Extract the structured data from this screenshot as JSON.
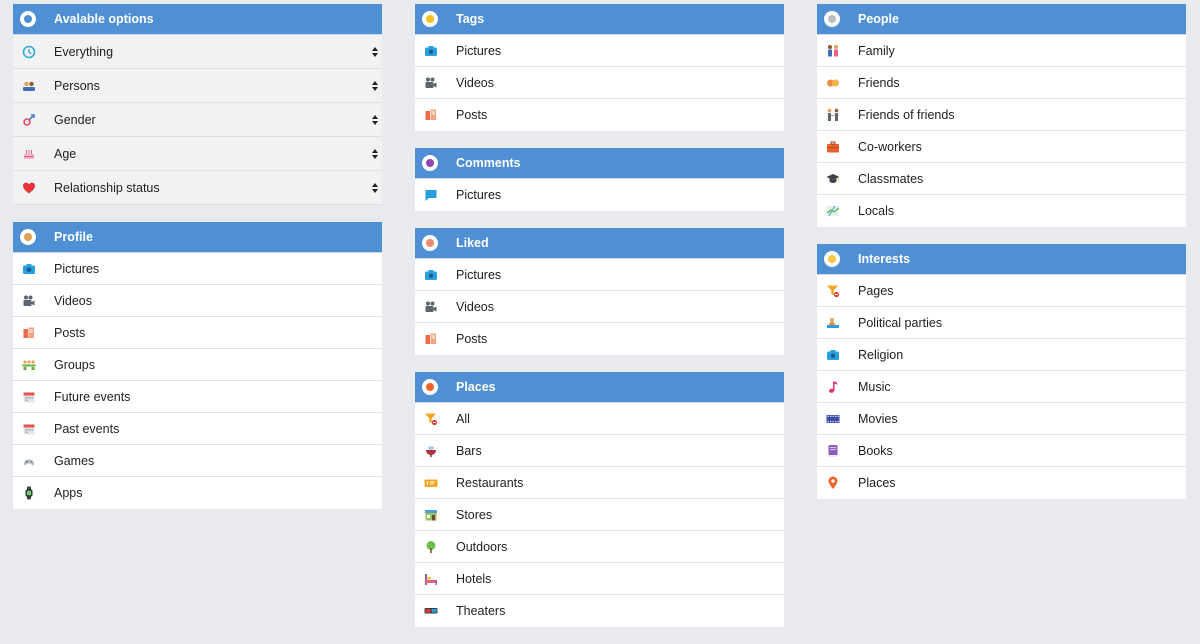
{
  "available_options": {
    "title": "Avalable options",
    "items": [
      {
        "label": "Everything"
      },
      {
        "label": "Persons"
      },
      {
        "label": "Gender"
      },
      {
        "label": "Age"
      },
      {
        "label": "Relationship status"
      }
    ]
  },
  "profile": {
    "title": "Profile",
    "items": [
      {
        "label": "Pictures"
      },
      {
        "label": "Videos"
      },
      {
        "label": "Posts"
      },
      {
        "label": "Groups"
      },
      {
        "label": "Future events"
      },
      {
        "label": "Past events"
      },
      {
        "label": "Games"
      },
      {
        "label": "Apps"
      }
    ]
  },
  "tags": {
    "title": "Tags",
    "items": [
      {
        "label": "Pictures"
      },
      {
        "label": "Videos"
      },
      {
        "label": "Posts"
      }
    ]
  },
  "comments": {
    "title": "Comments",
    "items": [
      {
        "label": "Pictures"
      }
    ]
  },
  "liked": {
    "title": "Liked",
    "items": [
      {
        "label": "Pictures"
      },
      {
        "label": "Videos"
      },
      {
        "label": "Posts"
      }
    ]
  },
  "places": {
    "title": "Places",
    "items": [
      {
        "label": "All"
      },
      {
        "label": "Bars"
      },
      {
        "label": "Restaurants"
      },
      {
        "label": "Stores"
      },
      {
        "label": "Outdoors"
      },
      {
        "label": "Hotels"
      },
      {
        "label": "Theaters"
      }
    ]
  },
  "people": {
    "title": "People",
    "items": [
      {
        "label": "Family"
      },
      {
        "label": "Friends"
      },
      {
        "label": "Friends of friends"
      },
      {
        "label": "Co-workers"
      },
      {
        "label": "Classmates"
      },
      {
        "label": "Locals"
      }
    ]
  },
  "interests": {
    "title": "Interests",
    "items": [
      {
        "label": "Pages"
      },
      {
        "label": "Political parties"
      },
      {
        "label": "Religion"
      },
      {
        "label": "Music"
      },
      {
        "label": "Movies"
      },
      {
        "label": "Books"
      },
      {
        "label": "Places"
      }
    ]
  },
  "colors": {
    "header_bg": "#4f8fd3",
    "page_bg": "#e9eaed"
  }
}
